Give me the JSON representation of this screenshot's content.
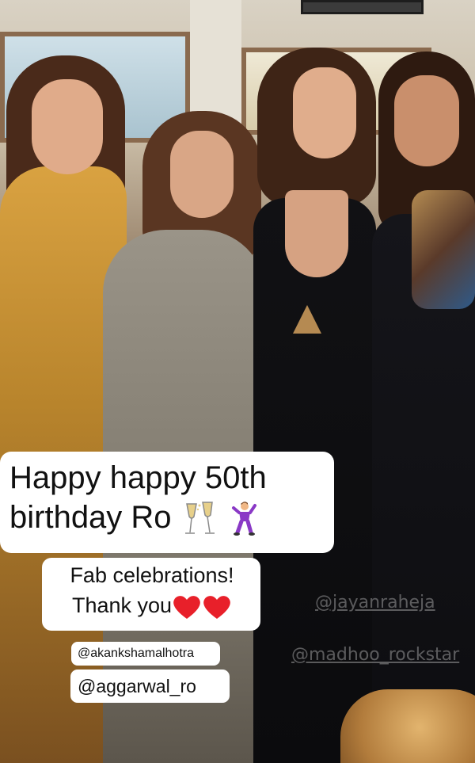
{
  "story": {
    "caption_line1": "Happy happy 50th",
    "caption_line2": "birthday Ro",
    "caption_line2_emojis": [
      "champagne-glasses-emoji",
      "dancing-man-emoji"
    ],
    "sub_line1": "Fab celebrations!",
    "sub_line2": "Thank you",
    "sub_line2_emojis": [
      "red-heart-emoji",
      "red-heart-emoji"
    ],
    "mention_1": "@akankshamalhotra",
    "mention_2": "@aggarwal_ro",
    "watermark_1": "@jayanraheja",
    "watermark_2": "@madhoo_rockstar"
  },
  "colors": {
    "sticker_bg": "#ffffff",
    "sticker_text": "#111111",
    "heart": "#e8202a",
    "champagne": "#e7d08a",
    "dancer_outfit": "#8a39c6"
  }
}
